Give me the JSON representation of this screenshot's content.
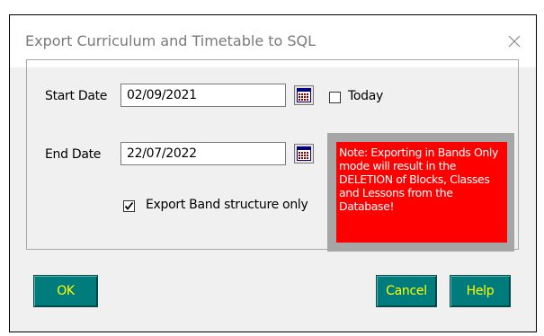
{
  "dialog": {
    "title": "Export Curriculum and Timetable to SQL"
  },
  "form": {
    "start_date_label": "Start Date",
    "start_date_value": "02/09/2021",
    "end_date_label": "End Date",
    "end_date_value": "22/07/2022",
    "today_label": "Today",
    "today_checked": false,
    "export_band_label": "Export Band structure only",
    "export_band_checked": true,
    "note": "Note: Exporting in Bands Only mode will  result in the DELETION of Blocks, Classes and Lessons from the Database!"
  },
  "buttons": {
    "ok": "OK",
    "cancel": "Cancel",
    "help": "Help"
  },
  "colors": {
    "button_bg": "#007c7c",
    "button_text": "#ffff00",
    "note_bg": "#ff0000",
    "note_text": "#ffffff"
  }
}
